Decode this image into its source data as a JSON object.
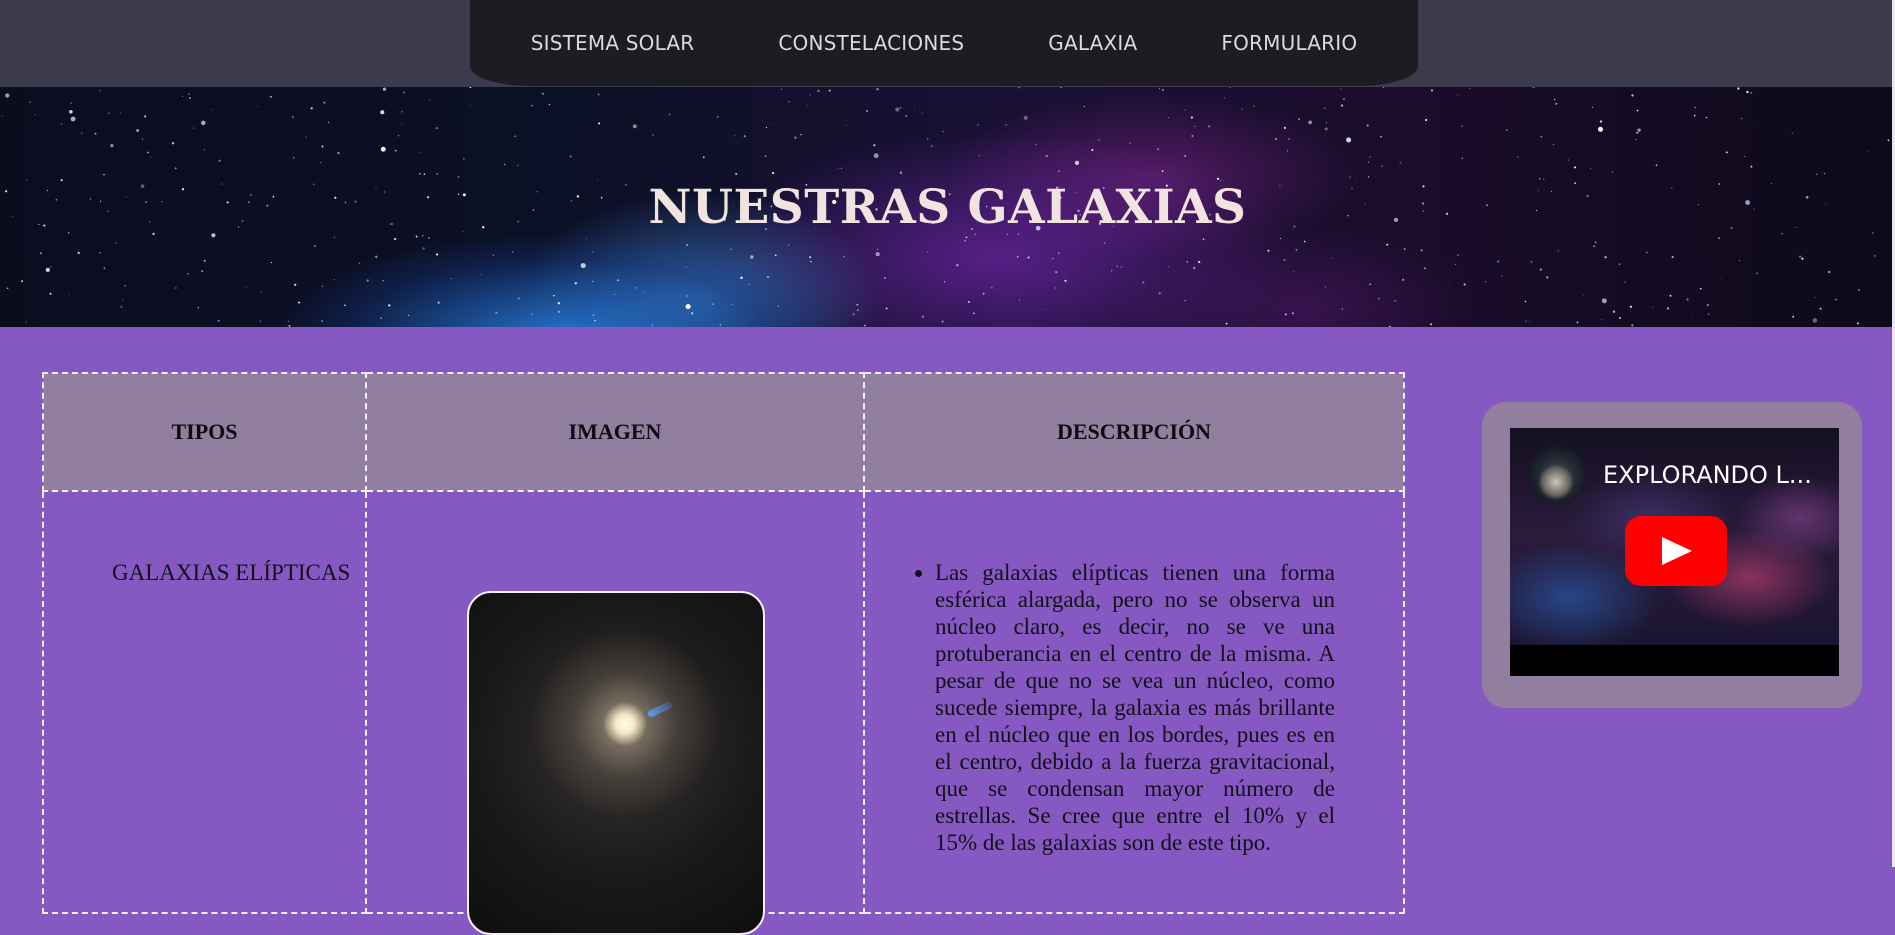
{
  "nav": {
    "items": [
      {
        "label": "SISTEMA SOLAR"
      },
      {
        "label": "CONSTELACIONES"
      },
      {
        "label": "GALAXIA"
      },
      {
        "label": "FORMULARIO"
      }
    ]
  },
  "banner": {
    "title": "NUESTRAS GALAXIAS"
  },
  "table": {
    "headers": {
      "tipos": "TIPOS",
      "imagen": "IMAGEN",
      "descripcion": "DESCRIPCIÓN"
    },
    "rows": [
      {
        "tipo": "GALAXIAS ELÍPTICAS",
        "image_icon": "elliptical-galaxy-image",
        "descripcion": "Las galaxias elípticas tienen una forma esférica alargada, pero no se observa un núcleo claro, es decir, no se ve una protuberancia en el centro de la misma. A pesar de que no se vea un núcleo, como sucede siempre, la galaxia es más brillante en el núcleo que en los bordes, pues es en el centro, debido a la fuerza gravitacional, que se condensan mayor número de estrellas. Se cree que entre el 10% y el 15% de las galaxias son de este tipo."
      }
    ]
  },
  "video": {
    "title": "EXPLORANDO L...",
    "play_icon": "youtube-play-icon"
  },
  "colors": {
    "page_background": "#8659c2",
    "top_bar": "#3c3b4d",
    "nav_pill": "#1d1c23",
    "table_header": "#927e9e",
    "youtube_red": "#ff0000"
  }
}
